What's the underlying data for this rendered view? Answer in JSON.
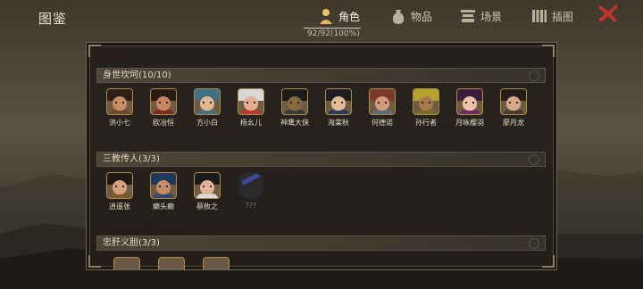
{
  "header": {
    "title": "图鉴",
    "tabs": [
      {
        "label": "角色",
        "icon": "person-icon",
        "active": true
      },
      {
        "label": "物品",
        "icon": "bag-icon",
        "active": false
      },
      {
        "label": "场景",
        "icon": "pavilion-icon",
        "active": false
      },
      {
        "label": "插图",
        "icon": "scroll-icon",
        "active": false
      }
    ],
    "progress_text": "92/92(100%)",
    "close_icon": "close-x-icon"
  },
  "sections": [
    {
      "title": "身世坎坷(10/10)",
      "characters": [
        {
          "name": "洪小七",
          "hair": "#2b1f17",
          "body": "#6a4a2a",
          "skin": "#c98f62"
        },
        {
          "name": "欧冶恒",
          "hair": "#2a1c14",
          "body": "#7a2c23",
          "skin": "#c58660"
        },
        {
          "name": "方小白",
          "hair": "#3d6f86",
          "body": "#4b6f7d",
          "skin": "#e1b692"
        },
        {
          "name": "杨幺儿",
          "hair": "#d8d8d8",
          "body": "#b9372f",
          "skin": "#e2b08e"
        },
        {
          "name": "神鹰大侠",
          "hair": "#1c1c1c",
          "body": "#3b3b3b",
          "skin": "#8a6a3d"
        },
        {
          "name": "海棠秋",
          "hair": "#1d1d22",
          "body": "#2c3a5a",
          "skin": "#e4bb98"
        },
        {
          "name": "何德诺",
          "hair": "#7b3b2c",
          "body": "#5c6a7a",
          "skin": "#d39b78"
        },
        {
          "name": "孙行者",
          "hair": "#b6a32c",
          "body": "#7b6b2a",
          "skin": "#a8794c"
        },
        {
          "name": "月咏樱羽",
          "hair": "#3a1d3d",
          "body": "#6d2f62",
          "skin": "#ecc3a8"
        },
        {
          "name": "廖月龙",
          "hair": "#241c18",
          "body": "#4a3d33",
          "skin": "#d8a985"
        }
      ]
    },
    {
      "title": "三教传人(3/3)",
      "characters": [
        {
          "name": "逍遥张",
          "hair": "#1f1a16",
          "body": "#7a5a2c",
          "skin": "#d6a27a"
        },
        {
          "name": "癞头癫",
          "hair": "#1d3a5d",
          "body": "#2d4a6a",
          "skin": "#c48e68"
        },
        {
          "name": "蔡攸之",
          "hair": "#1a1a1e",
          "body": "#d8d8d8",
          "skin": "#e2b695"
        },
        {
          "name": "???",
          "locked": true
        }
      ]
    },
    {
      "title": "忠肝义胆(3/3)",
      "characters": []
    }
  ],
  "colors": {
    "accent_gold": "#b38a3f",
    "close_red": "#c8322c",
    "panel_bg": "#221f1b"
  }
}
